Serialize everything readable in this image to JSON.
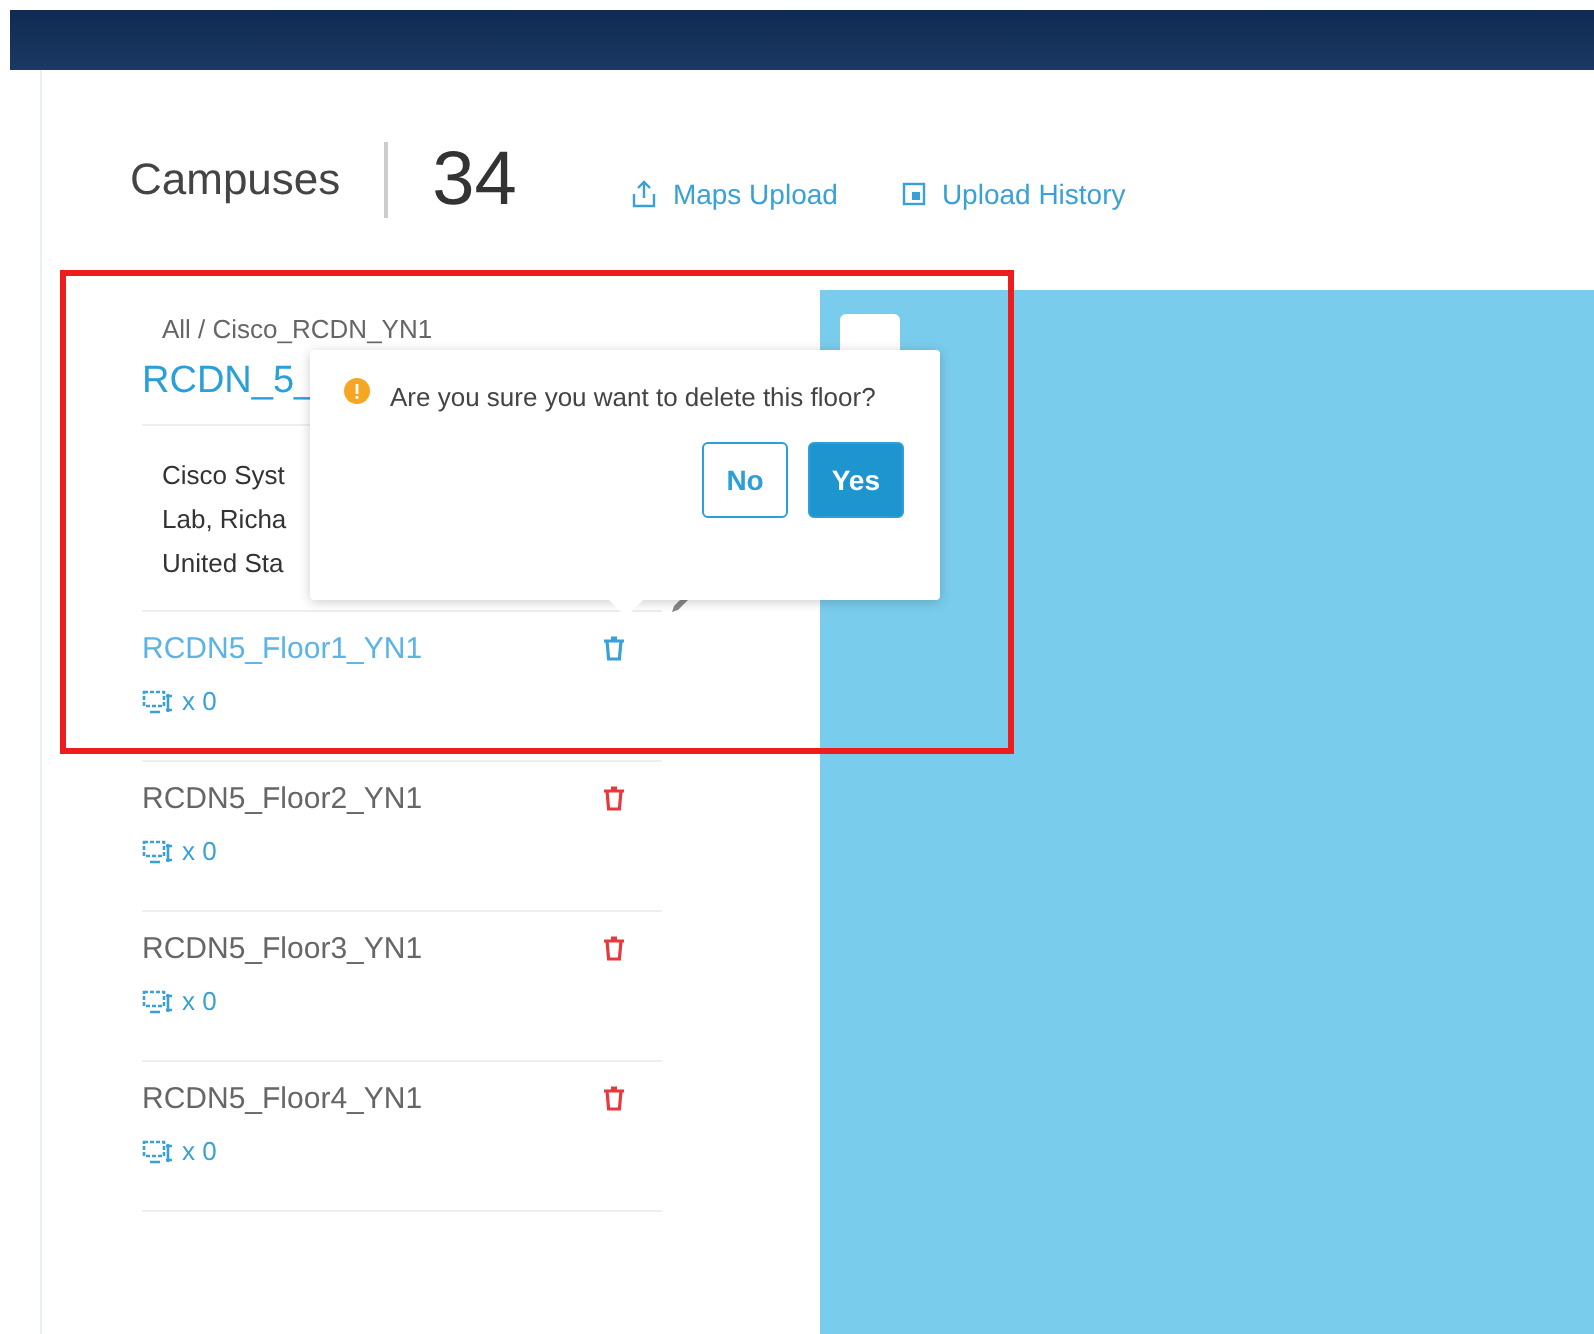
{
  "header": {
    "title": "Campuses",
    "count": "34",
    "actions": [
      {
        "label": "Maps Upload",
        "kind": "upload"
      },
      {
        "label": "Upload History",
        "kind": "history"
      }
    ]
  },
  "site": {
    "breadcrumb": "All / Cisco_RCDN_YN1",
    "name": "RCDN_5_",
    "address_lines": [
      "Cisco Syst",
      "Lab, Richa",
      "United Sta"
    ]
  },
  "floors": [
    {
      "name": "RCDN5_Floor1_YN1",
      "devices": "x 0",
      "selected": true
    },
    {
      "name": "RCDN5_Floor2_YN1",
      "devices": "x 0",
      "selected": false
    },
    {
      "name": "RCDN5_Floor3_YN1",
      "devices": "x 0",
      "selected": false
    },
    {
      "name": "RCDN5_Floor4_YN1",
      "devices": "x 0",
      "selected": false
    }
  ],
  "dialog": {
    "message": "Are you sure you want to delete this floor?",
    "buttons": [
      {
        "label": "No",
        "kind": "secondary"
      },
      {
        "label": "Yes",
        "kind": "primary"
      }
    ]
  }
}
